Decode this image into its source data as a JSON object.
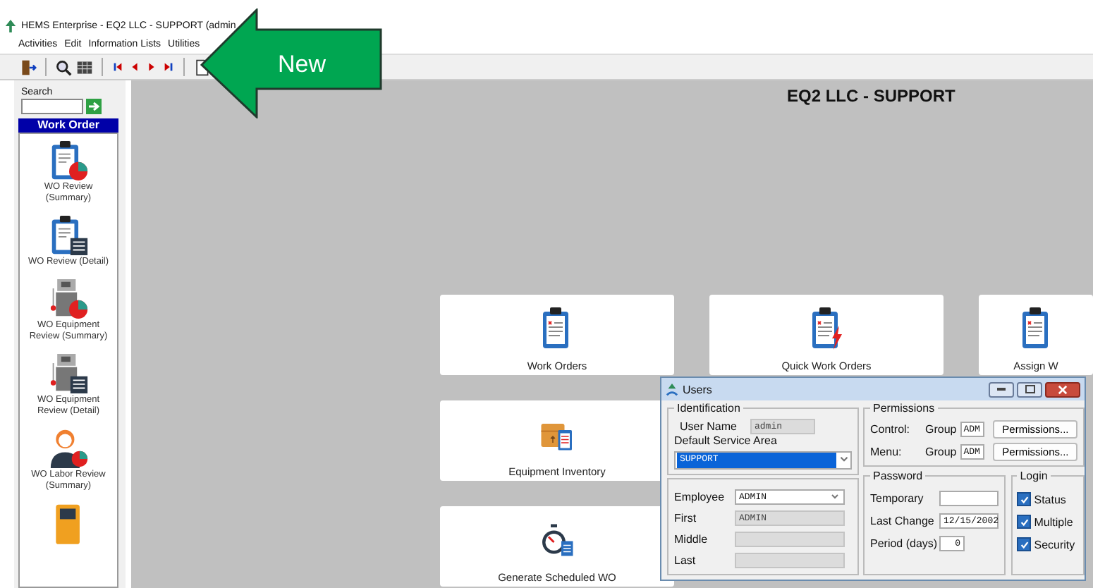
{
  "window": {
    "title": "HEMS Enterprise - EQ2 LLC - SUPPORT (admin"
  },
  "menu": [
    {
      "label": "Activities"
    },
    {
      "label": "Edit"
    },
    {
      "label": "Information Lists"
    },
    {
      "label": "Utilities"
    }
  ],
  "sidebar": {
    "search_label": "Search",
    "section": "Work Order",
    "items": [
      {
        "label": "WO Review (Summary)",
        "kind": "clipboard-chart"
      },
      {
        "label": "WO Review (Detail)",
        "kind": "clipboard-list"
      },
      {
        "label": "WO Equipment Review (Summary)",
        "kind": "equipment-chart"
      },
      {
        "label": "WO Equipment Review (Detail)",
        "kind": "equipment-list"
      },
      {
        "label": "WO Labor Review (Summary)",
        "kind": "person-chart"
      },
      {
        "kind": "device"
      }
    ]
  },
  "main": {
    "heading": "EQ2 LLC - SUPPORT",
    "tile_rows": [
      [
        {
          "label": "Work Orders",
          "kind": "clipboard"
        },
        {
          "label": "Quick Work Orders",
          "kind": "clipboard-bolt"
        },
        {
          "label": "Assign W",
          "kind": "clipboard"
        }
      ],
      [
        {
          "label": "Equipment Inventory",
          "kind": "box"
        }
      ],
      [
        {
          "label": "Generate Scheduled WO",
          "kind": "stopwatch"
        }
      ]
    ]
  },
  "callout": {
    "label": "New"
  },
  "dialog": {
    "title": "Users",
    "identification": {
      "title": "Identification",
      "user_name_label": "User Name",
      "user_name": "admin",
      "service_area_label": "Default Service Area",
      "service_area": "SUPPORT"
    },
    "permissions": {
      "title": "Permissions",
      "rows": [
        {
          "label": "Control:",
          "group_label": "Group",
          "group": "ADM",
          "button": "Permissions..."
        },
        {
          "label": "Menu:",
          "group_label": "Group",
          "group": "ADM",
          "button": "Permissions..."
        }
      ]
    },
    "employee": {
      "fields": [
        {
          "label": "Employee",
          "value": "ADMIN",
          "kind": "select",
          "disabled": false
        },
        {
          "label": "First",
          "value": "ADMIN",
          "kind": "text",
          "disabled": true
        },
        {
          "label": "Middle",
          "kind": "text",
          "disabled": true
        },
        {
          "label": "Last",
          "kind": "text",
          "disabled": true
        }
      ]
    },
    "password": {
      "title": "Password",
      "fields": [
        {
          "label": "Temporary",
          "disabled": false
        },
        {
          "label": "Last Change",
          "value": "12/15/2002",
          "disabled": false
        },
        {
          "label": "Period (days)",
          "value": "0",
          "disabled": false
        }
      ]
    },
    "login": {
      "title": "Login",
      "options": [
        {
          "label": "Status",
          "checked": true
        },
        {
          "label": "Multiple",
          "checked": true
        },
        {
          "label": "Security",
          "checked": true
        }
      ]
    }
  }
}
